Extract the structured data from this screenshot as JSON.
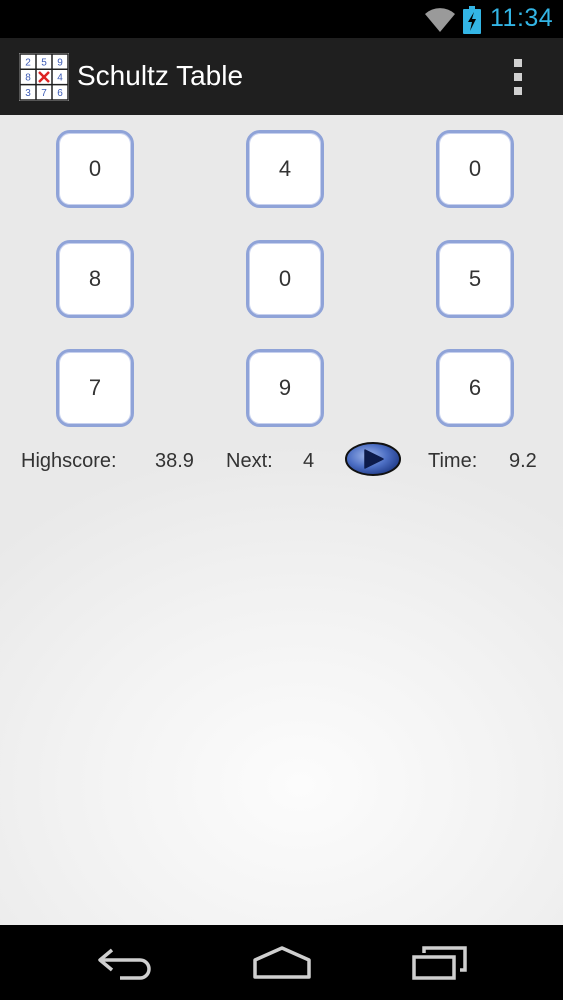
{
  "status_bar": {
    "time": "11:34",
    "accent_color": "#33b5e5"
  },
  "action_bar": {
    "title": "Schultz Table",
    "app_icon_digits": [
      "2",
      "5",
      "9",
      "8",
      "",
      "4",
      "3",
      "7",
      "6"
    ],
    "background": "#1f1f1f"
  },
  "grid": {
    "cells": [
      "0",
      "4",
      "0",
      "8",
      "0",
      "5",
      "7",
      "9",
      "6"
    ],
    "border_color": "#8fa3d8"
  },
  "info": {
    "highscore_label": "Highscore:",
    "highscore_value": "38.9",
    "next_label": "Next:",
    "next_value": "4",
    "time_label": "Time:",
    "time_value": "9.2"
  },
  "icons": {
    "status": [
      "wifi-icon",
      "battery-charging-icon"
    ],
    "action_bar": [
      "app-logo-icon",
      "overflow-menu-icon"
    ],
    "controls": [
      "play-icon"
    ],
    "navigation": [
      "back-icon",
      "home-icon",
      "recent-apps-icon"
    ]
  }
}
